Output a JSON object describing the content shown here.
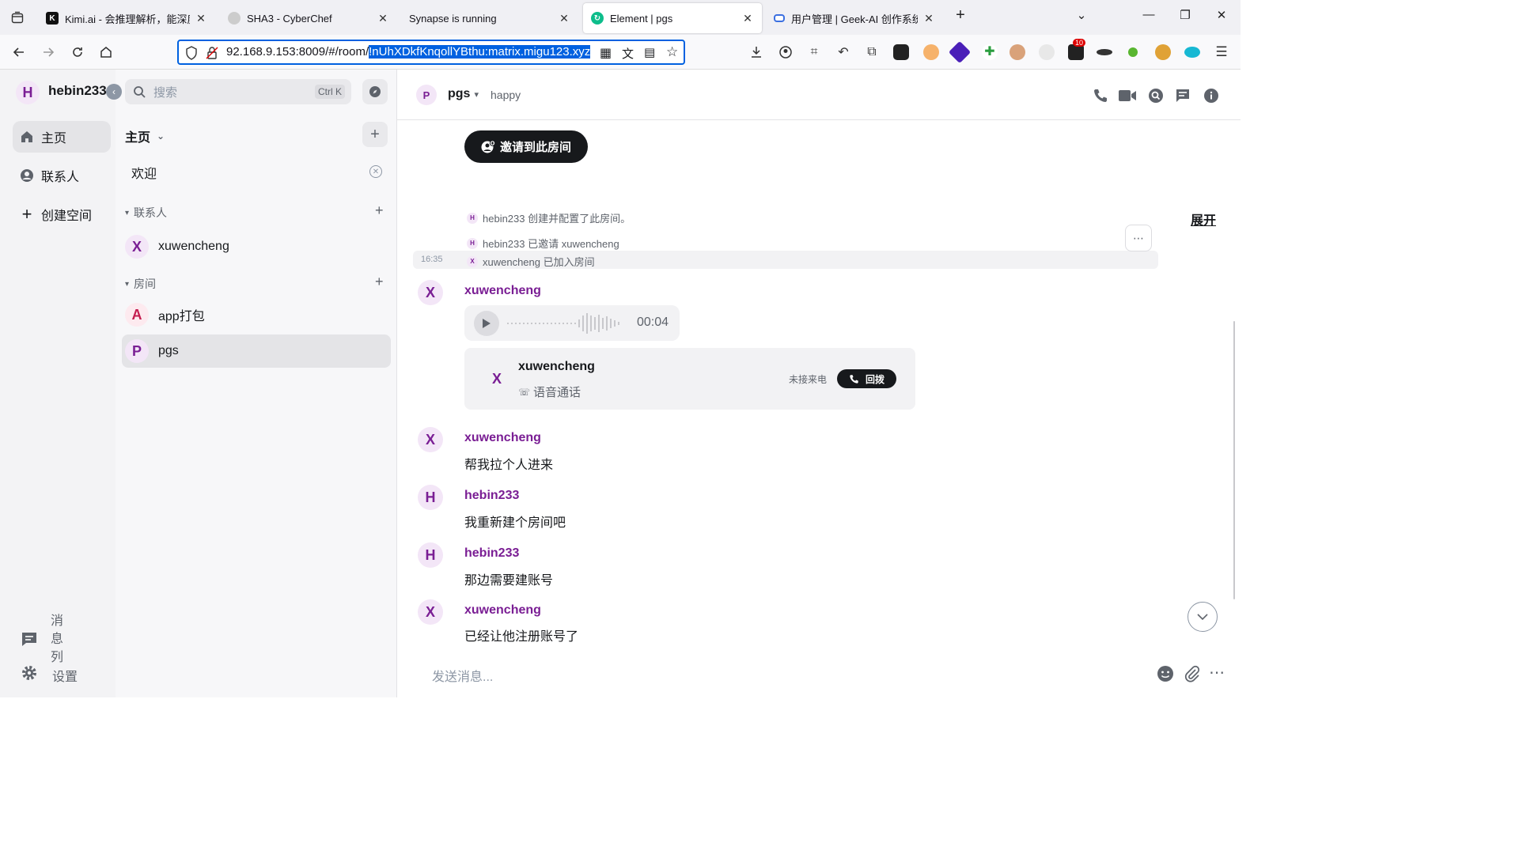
{
  "browser": {
    "tabs": [
      {
        "title": "Kimi.ai - 会推理解析，能深度思考的AI助手"
      },
      {
        "title": "SHA3 - CyberChef"
      },
      {
        "title": "Synapse is running"
      },
      {
        "title": "Element | pgs"
      },
      {
        "title": "用户管理 | Geek-AI 创作系统"
      }
    ],
    "url": {
      "prefix": "92.168.9.153:8009/#/room/",
      "selected": "!nUhXDkfKnqollYBthu:matrix.migu123.xyz"
    },
    "badge_count": "10"
  },
  "spaces": {
    "user": {
      "initial": "H",
      "name": "hebin233"
    },
    "items": [
      {
        "label": "主页"
      },
      {
        "label": "联系人"
      },
      {
        "label": "创建空间"
      }
    ],
    "threads_label": "消息列表",
    "threads_chars": [
      "消",
      "息",
      "列"
    ],
    "settings_label": "设置"
  },
  "roomlist": {
    "search_placeholder": "搜索",
    "search_shortcut": "Ctrl K",
    "home_title": "主页",
    "welcome": "欢迎",
    "contacts_header": "联系人",
    "contacts": [
      {
        "initial": "X",
        "name": "xuwencheng"
      }
    ],
    "rooms_header": "房间",
    "rooms": [
      {
        "initial": "A",
        "name": "app打包"
      },
      {
        "initial": "P",
        "name": "pgs"
      }
    ]
  },
  "room": {
    "initial": "P",
    "name": "pgs",
    "topic": "happy",
    "invite_button": "邀请到此房间",
    "expand_label": "展开",
    "events": [
      {
        "initial": "H",
        "text": "hebin233 创建并配置了此房间。"
      },
      {
        "initial": "H",
        "text": "hebin233 已邀请 xuwencheng"
      },
      {
        "initial": "X",
        "text": "xuwencheng 已加入房间",
        "time": "16:35"
      }
    ],
    "messages": [
      {
        "initial": "X",
        "sender": "xuwencheng",
        "voice_duration": "00:04"
      },
      {
        "call_name": "xuwencheng",
        "call_type": "语音通话",
        "call_status": "未接来电",
        "call_back": "回拨"
      },
      {
        "initial": "X",
        "sender": "xuwencheng",
        "text": "帮我拉个人进来"
      },
      {
        "initial": "H",
        "sender": "hebin233",
        "text": "我重新建个房间吧"
      },
      {
        "initial": "H",
        "sender": "hebin233",
        "text": "那边需要建账号"
      },
      {
        "initial": "X",
        "sender": "xuwencheng",
        "text": "已经让他注册账号了"
      }
    ],
    "composer_placeholder": "发送消息..."
  }
}
